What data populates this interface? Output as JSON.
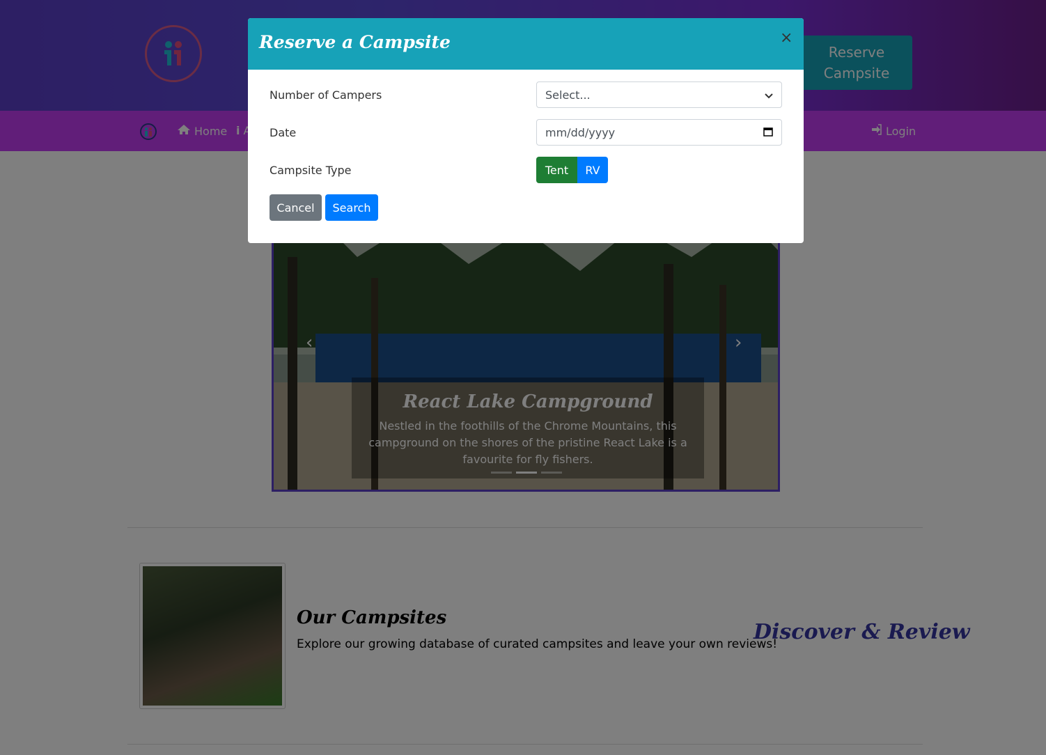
{
  "header": {
    "reserve_button": "Reserve Campsite"
  },
  "nav": {
    "home": "Home",
    "about_partial": "A",
    "login": "Login"
  },
  "carousel": {
    "title": "React Lake Campground",
    "text": "Nestled in the foothills of the Chrome Mountains, this campground on the shores of the pristine React Lake is a favourite for fly fishers.",
    "indicators": 3,
    "active_index": 1
  },
  "section": {
    "title": "Our Campsites",
    "text": "Explore our growing database of curated campsites and leave your own reviews!",
    "tag": "Discover & Review"
  },
  "modal": {
    "title": "Reserve a Campsite",
    "close": "×",
    "campers_label": "Number of Campers",
    "campers_value": "Select...",
    "date_label": "Date",
    "date_placeholder": "mm/dd/yyyy",
    "type_label": "Campsite Type",
    "type_options": [
      "Tent",
      "RV"
    ],
    "type_selected": "Tent",
    "cancel": "Cancel",
    "search": "Search"
  },
  "colors": {
    "primary": "#007bff",
    "info": "#17a2b8",
    "success": "#1e7e34",
    "secondary": "#6c757d",
    "nav": "#c33cf2",
    "accent": "#3434a0"
  }
}
